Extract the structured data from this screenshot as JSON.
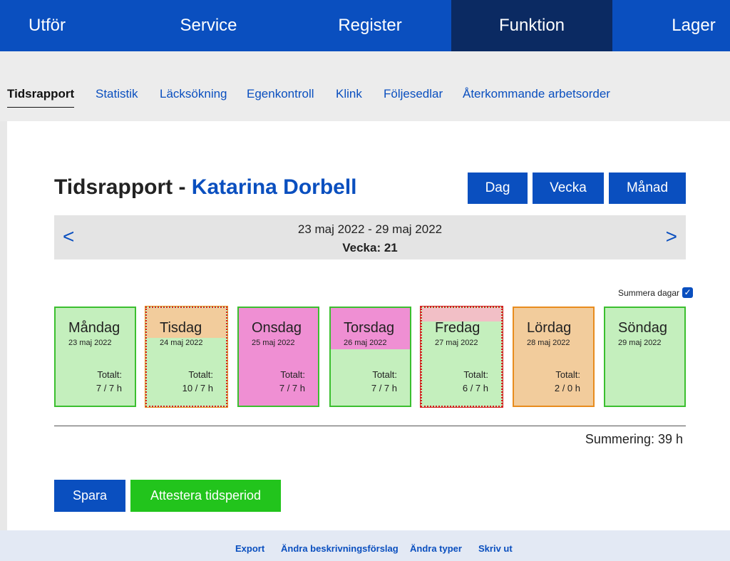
{
  "topnav": {
    "items": [
      "Utför",
      "Service",
      "Register",
      "Funktion",
      "Lager"
    ],
    "active": "Funktion"
  },
  "subnav": {
    "items": [
      "Tidsrapport",
      "Statistik",
      "Läcksökning",
      "Egenkontroll",
      "Klink",
      "Följesedlar",
      "Återkommande arbetsorder"
    ],
    "active": "Tidsrapport"
  },
  "page": {
    "title_prefix": "Tidsrapport - ",
    "person": "Katarina Dorbell"
  },
  "view_buttons": {
    "day": "Dag",
    "week": "Vecka",
    "month": "Månad"
  },
  "week_bar": {
    "range": "23 maj 2022 - 29 maj 2022",
    "week": "Vecka: 21",
    "prev": "<",
    "next": ">"
  },
  "summera_dagar": {
    "label": "Summera dagar",
    "checked": true,
    "check": "✓"
  },
  "days": [
    {
      "name": "Måndag",
      "date": "23 maj 2022",
      "total_label": "Totalt:",
      "total": "7 / 7 h",
      "status": "ok"
    },
    {
      "name": "Tisdag",
      "date": "24 maj 2022",
      "total_label": "Totalt:",
      "total": "10 / 7 h",
      "status": "overtime"
    },
    {
      "name": "Onsdag",
      "date": "25 maj 2022",
      "total_label": "Totalt:",
      "total": "7 / 7 h",
      "status": "pink"
    },
    {
      "name": "Torsdag",
      "date": "26 maj 2022",
      "total_label": "Totalt:",
      "total": "7 / 7 h",
      "status": "partial-pink"
    },
    {
      "name": "Fredag",
      "date": "27 maj 2022",
      "total_label": "Totalt:",
      "total": "6 / 7 h",
      "status": "under"
    },
    {
      "name": "Lördag",
      "date": "28 maj 2022",
      "total_label": "Totalt:",
      "total": "2 / 0 h",
      "status": "orange"
    },
    {
      "name": "Söndag",
      "date": "29 maj 2022",
      "total_label": "",
      "total": "",
      "status": "ok"
    }
  ],
  "summary": "Summering: 39 h",
  "actions": {
    "save": "Spara",
    "attest": "Attestera tidsperiod"
  },
  "footer": {
    "links": [
      "Export",
      "Ändra beskrivningsförslag",
      "Ändra typer",
      "Skriv ut"
    ]
  },
  "colors": {
    "nav_blue": "#0a4fbf",
    "nav_active": "#0b2a62",
    "green_fill": "#c4efbd",
    "green_border": "#3bbf2f",
    "orange_fill": "#f2cc9c",
    "orange_border": "#e88c1e",
    "pink_fill": "#ef8fd3",
    "light_red": "#f2bfc6",
    "red_border": "#d42020",
    "attest_green": "#22c41c"
  }
}
